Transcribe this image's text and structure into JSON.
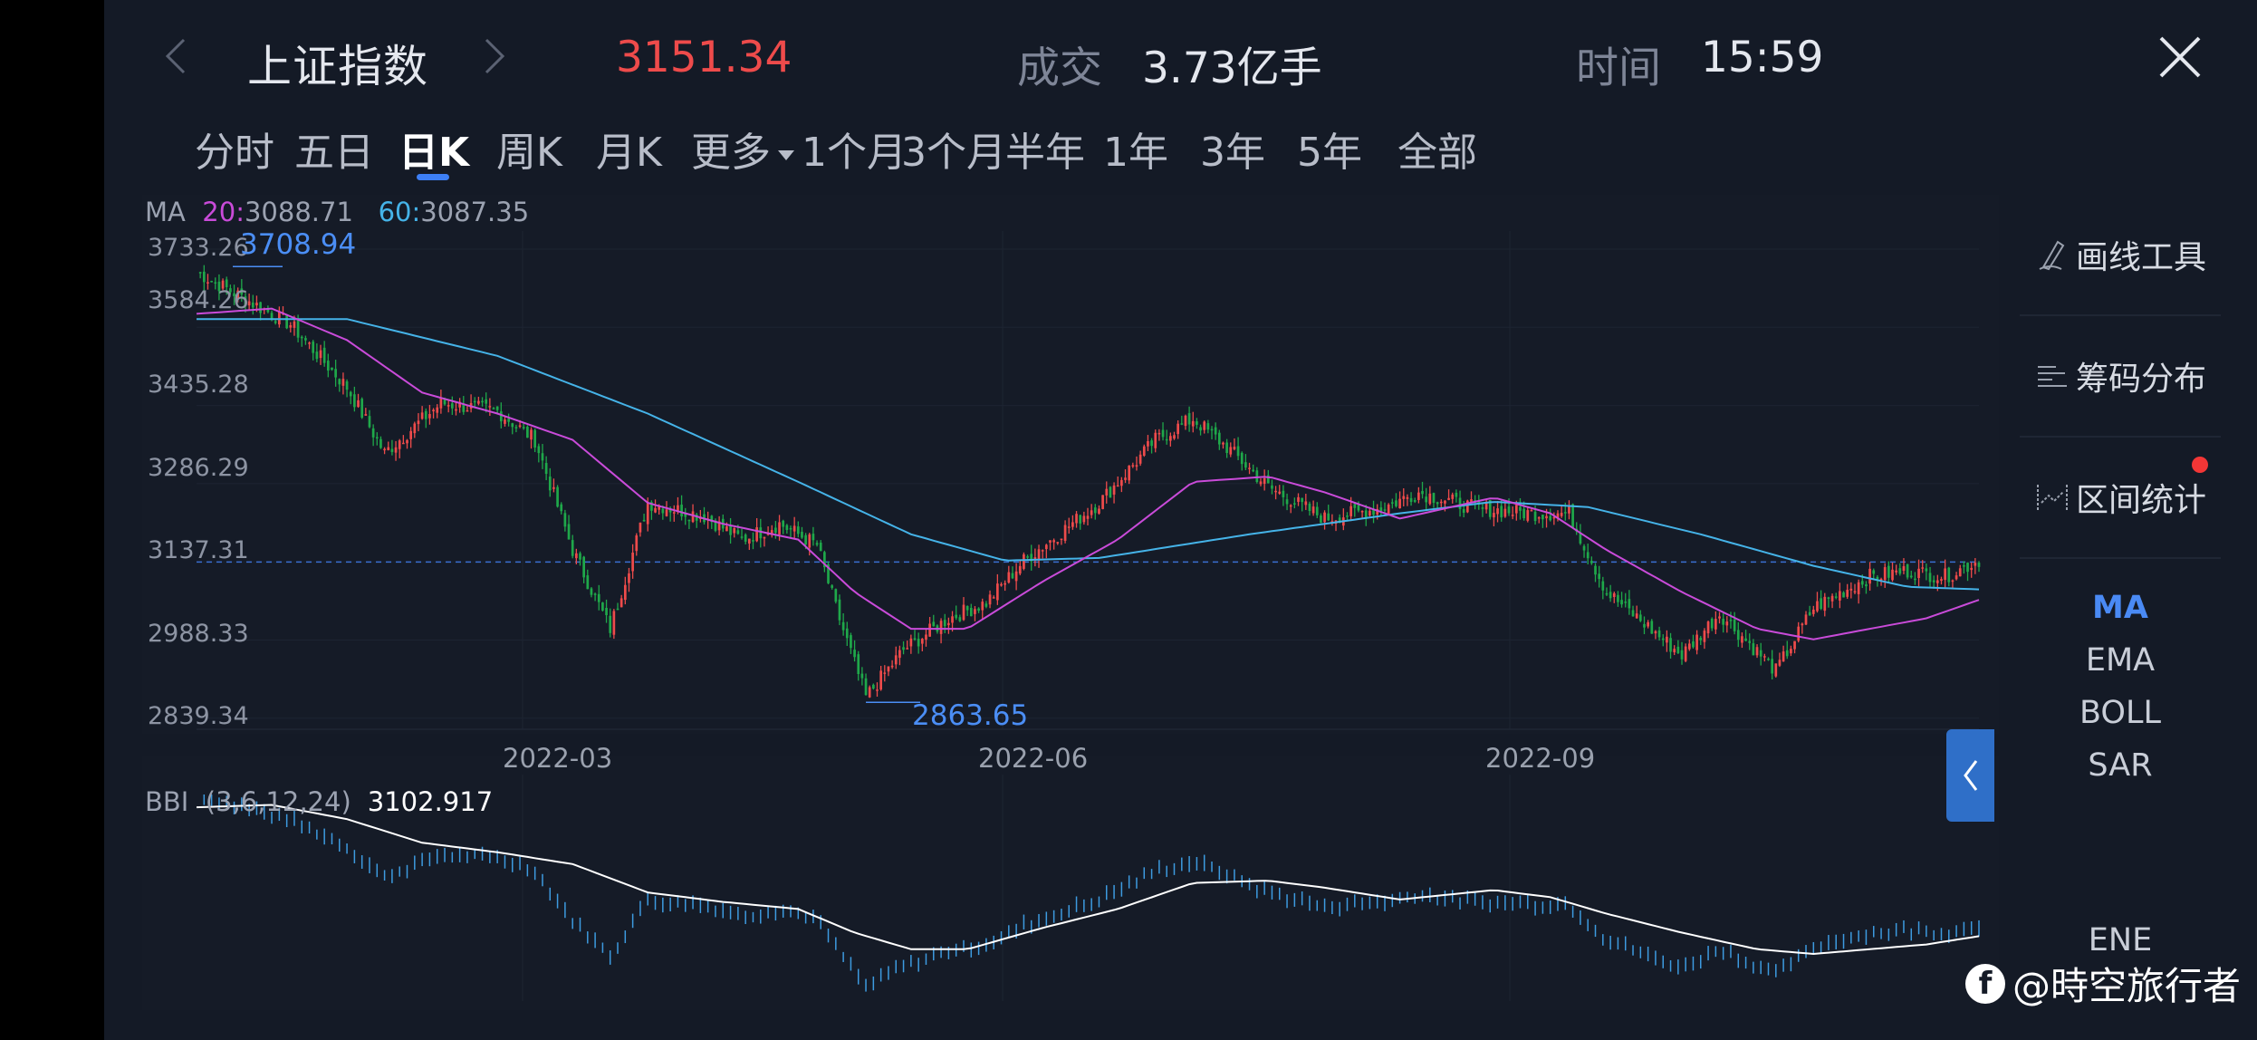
{
  "header": {
    "index_name": "上证指数",
    "price": "3151.34",
    "volume_label": "成交",
    "volume_value": "3.73亿手",
    "time_label": "时间",
    "time_value": "15:59"
  },
  "tabs": [
    "分时",
    "五日",
    "日K",
    "周K",
    "月K",
    "更多",
    "1个月",
    "3个月",
    "半年",
    "1年",
    "3年",
    "5年",
    "全部"
  ],
  "active_tab": "日K",
  "ma_legend": {
    "label": "MA",
    "ma20_label": "20:",
    "ma20_value": "3088.71",
    "ma60_label": "60:",
    "ma60_value": "3087.35"
  },
  "main_axis": {
    "y_ticks": [
      "3733.26",
      "3584.26",
      "3435.28",
      "3286.29",
      "3137.31",
      "2988.33",
      "2839.34"
    ],
    "x_ticks": [
      "2022-03",
      "2022-06",
      "2022-09"
    ]
  },
  "annotations": {
    "high": "3708.94",
    "low": "2863.65"
  },
  "bbi": {
    "label": "BBI",
    "params": "(3,6,12,24)",
    "value": "3102.917"
  },
  "right_panel": {
    "tools": [
      "画线工具",
      "筹码分布",
      "区间统计"
    ],
    "indicators": [
      "MA",
      "EMA",
      "BOLL",
      "SAR",
      "ENE"
    ],
    "active_indicator": "MA"
  },
  "watermark": "@時空旅行者",
  "colors": {
    "up": "#ee4b4b",
    "down": "#1fa84a",
    "ma20": "#c94bd9",
    "ma60": "#45b3e8",
    "accent": "#3d7ff5",
    "bg": "#141a26"
  },
  "chart_data": {
    "type": "candlestick",
    "y_range": [
      2839.34,
      3733.26
    ],
    "current_line": 3137.31,
    "anchors": [
      [
        0,
        3690
      ],
      [
        10,
        3650
      ],
      [
        25,
        3590
      ],
      [
        40,
        3470
      ],
      [
        50,
        3345
      ],
      [
        65,
        3440
      ],
      [
        80,
        3425
      ],
      [
        90,
        3370
      ],
      [
        100,
        3160
      ],
      [
        110,
        3010
      ],
      [
        120,
        3250
      ],
      [
        135,
        3225
      ],
      [
        145,
        3180
      ],
      [
        155,
        3210
      ],
      [
        165,
        3170
      ],
      [
        170,
        3050
      ],
      [
        178,
        2880
      ],
      [
        188,
        2970
      ],
      [
        200,
        3030
      ],
      [
        210,
        3060
      ],
      [
        220,
        3140
      ],
      [
        240,
        3250
      ],
      [
        255,
        3370
      ],
      [
        265,
        3410
      ],
      [
        275,
        3350
      ],
      [
        285,
        3280
      ],
      [
        300,
        3220
      ],
      [
        315,
        3240
      ],
      [
        325,
        3270
      ],
      [
        340,
        3240
      ],
      [
        355,
        3230
      ],
      [
        365,
        3230
      ],
      [
        375,
        3080
      ],
      [
        385,
        3020
      ],
      [
        395,
        2960
      ],
      [
        405,
        3040
      ],
      [
        420,
        2930
      ],
      [
        430,
        3050
      ],
      [
        445,
        3110
      ],
      [
        455,
        3120
      ],
      [
        465,
        3110
      ],
      [
        474,
        3140
      ]
    ],
    "ma20_points": [
      [
        0,
        3610
      ],
      [
        20,
        3620
      ],
      [
        40,
        3560
      ],
      [
        60,
        3460
      ],
      [
        80,
        3420
      ],
      [
        100,
        3370
      ],
      [
        120,
        3250
      ],
      [
        140,
        3210
      ],
      [
        160,
        3180
      ],
      [
        175,
        3080
      ],
      [
        190,
        3010
      ],
      [
        205,
        3010
      ],
      [
        225,
        3100
      ],
      [
        245,
        3180
      ],
      [
        265,
        3290
      ],
      [
        285,
        3300
      ],
      [
        300,
        3270
      ],
      [
        320,
        3220
      ],
      [
        345,
        3260
      ],
      [
        360,
        3230
      ],
      [
        375,
        3160
      ],
      [
        395,
        3080
      ],
      [
        415,
        3010
      ],
      [
        430,
        2990
      ],
      [
        445,
        3010
      ],
      [
        460,
        3030
      ],
      [
        474,
        3065
      ]
    ],
    "ma60_points": [
      [
        0,
        3600
      ],
      [
        40,
        3600
      ],
      [
        80,
        3530
      ],
      [
        120,
        3420
      ],
      [
        160,
        3290
      ],
      [
        190,
        3190
      ],
      [
        215,
        3140
      ],
      [
        240,
        3145
      ],
      [
        280,
        3190
      ],
      [
        320,
        3230
      ],
      [
        345,
        3252
      ],
      [
        370,
        3242
      ],
      [
        400,
        3190
      ],
      [
        430,
        3130
      ],
      [
        455,
        3090
      ],
      [
        474,
        3085
      ]
    ]
  }
}
